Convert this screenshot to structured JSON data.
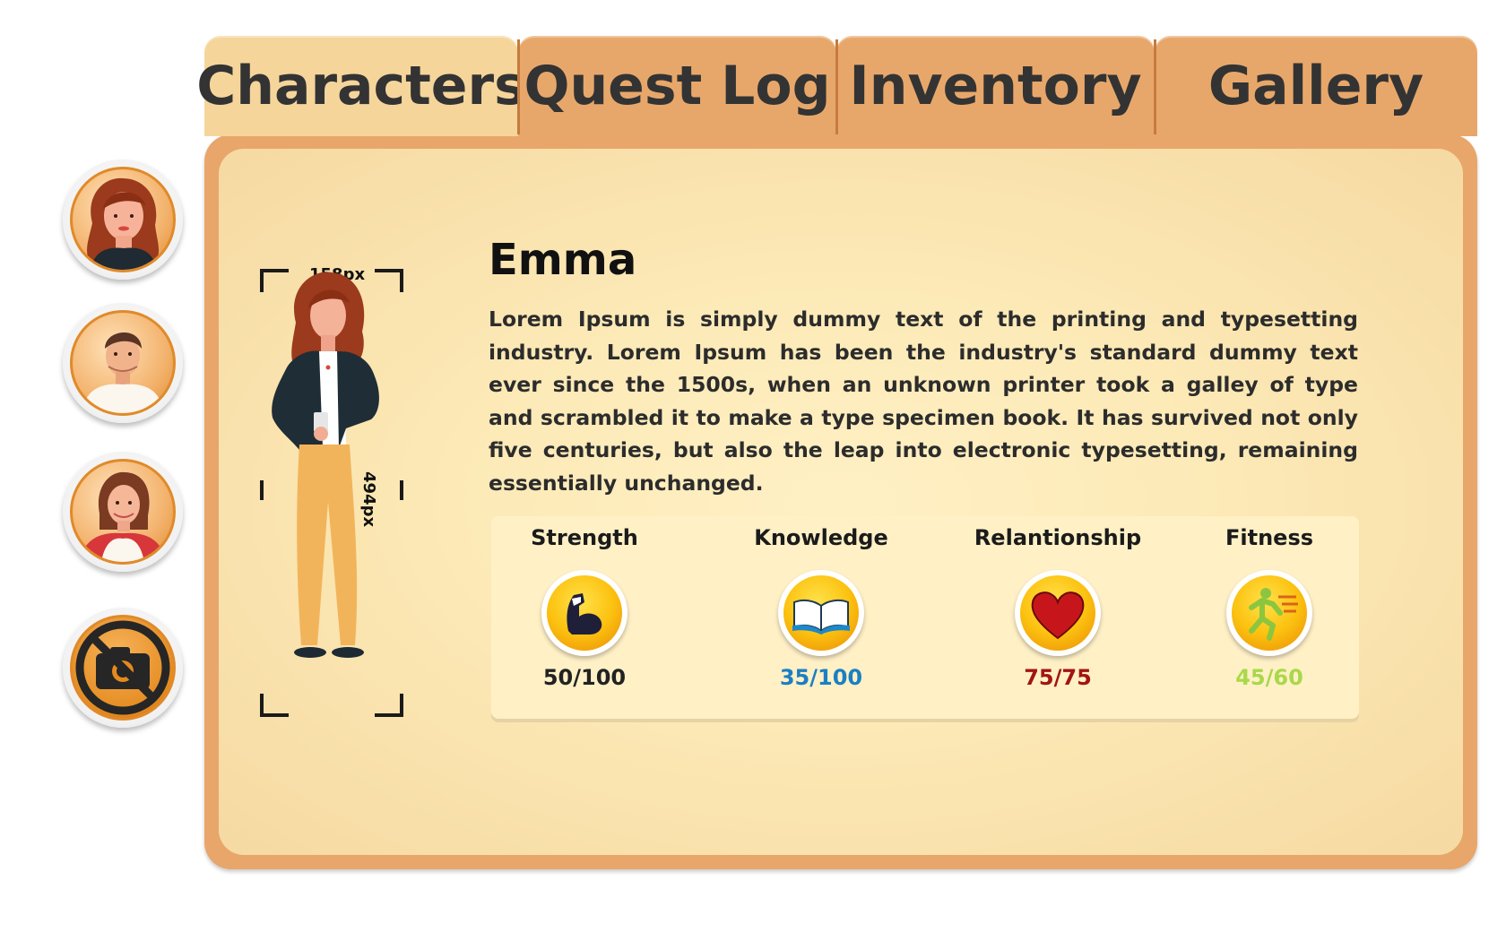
{
  "tabs": [
    {
      "label": "Characters",
      "active": true
    },
    {
      "label": "Quest Log",
      "active": false
    },
    {
      "label": "Inventory",
      "active": false
    },
    {
      "label": "Gallery",
      "active": false
    }
  ],
  "sidebar": {
    "avatars": [
      {
        "name": "avatar-emma"
      },
      {
        "name": "avatar-man"
      },
      {
        "name": "avatar-woman-red"
      },
      {
        "name": "avatar-locked-no-camera"
      }
    ]
  },
  "character": {
    "name": "Emma",
    "description": "Lorem Ipsum is simply dummy text of the printing and typesetting industry. Lorem Ipsum has been the industry's standard dummy text ever since the 1500s, when an unknown printer took a galley of type and scrambled it to make a type specimen book. It has survived not only five centuries, but also the leap into electronic typesetting, remaining essentially unchanged.",
    "measure_width_label": "158px",
    "measure_height_label": "494px"
  },
  "stats": [
    {
      "label": "Strength",
      "value": "50/100",
      "color": "#222222",
      "icon": "muscle-icon"
    },
    {
      "label": "Knowledge",
      "value": "35/100",
      "color": "#1a7fc4",
      "icon": "book-icon"
    },
    {
      "label": "Relantionship",
      "value": "75/75",
      "color": "#a01515",
      "icon": "heart-icon"
    },
    {
      "label": "Fitness",
      "value": "45/60",
      "color": "#a9d84a",
      "icon": "runner-icon"
    }
  ],
  "colors": {
    "panel_border": "#e9a66a",
    "paper": "#fce9b6",
    "tab": "#e8a76a",
    "tab_active": "#f6d59b",
    "avatar_ring": "#e08a2a"
  }
}
